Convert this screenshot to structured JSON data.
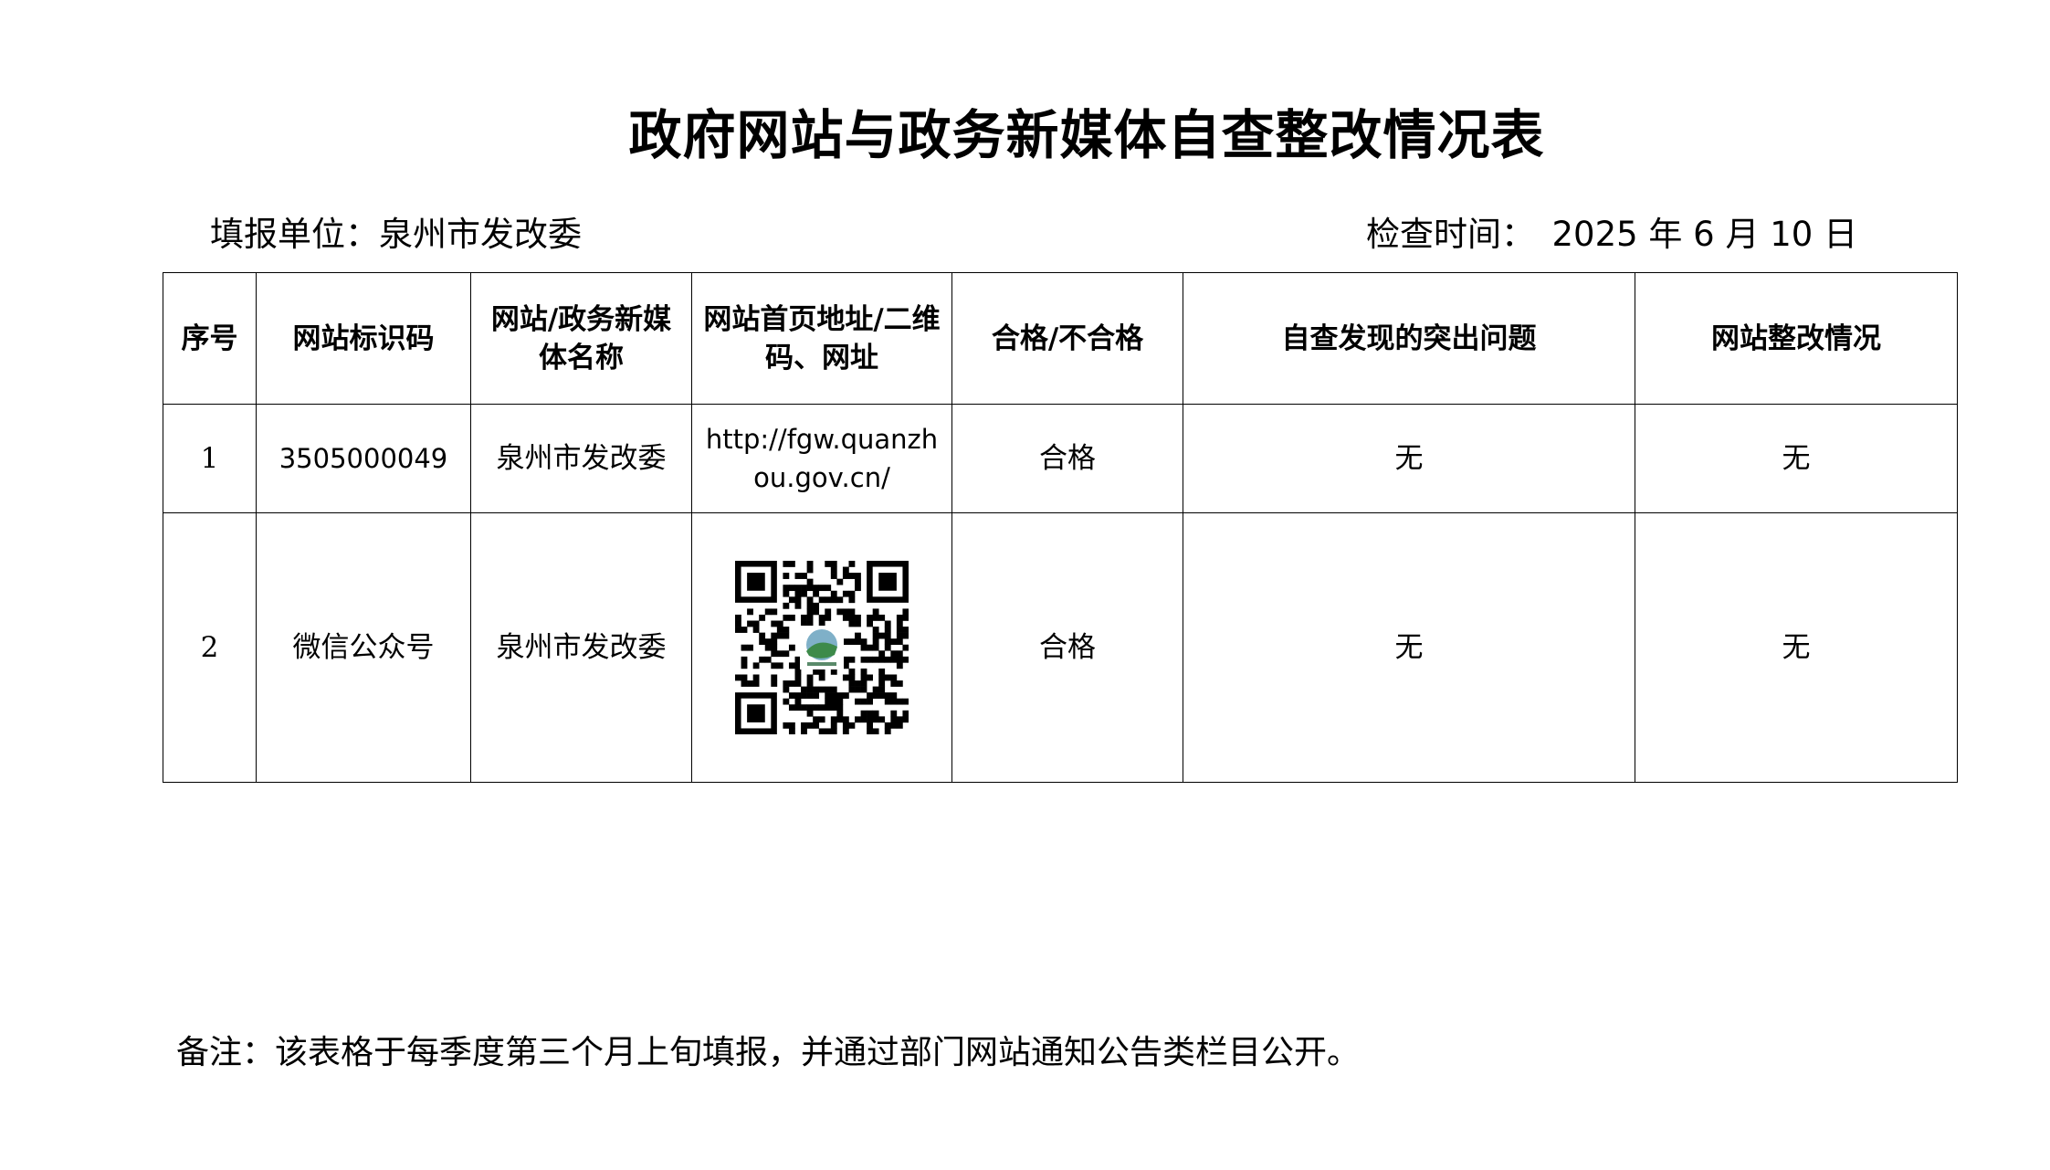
{
  "document": {
    "title": "政府网站与政务新媒体自查整改情况表",
    "reporter": "填报单位：泉州市发改委",
    "check_time": "检查时间：　2025 年 6 月 10 日"
  },
  "table": {
    "headers": [
      "序号",
      "网站标识码",
      "网站/政务新媒体名称",
      "网站首页地址/二维码、网址",
      "合格/不合格",
      "自查发现的突出问题",
      "网站整改情况"
    ],
    "rows": [
      {
        "index": "1",
        "site_code": "3505000049",
        "name": "泉州市发改委",
        "address": "http://fgw.quanzhou.gov.cn/",
        "status": "合格",
        "issues": "无",
        "rectification": "无"
      },
      {
        "index": "2",
        "site_code": "微信公众号",
        "name": "泉州市发改委",
        "address_icon": "qr-code-icon",
        "status": "合格",
        "issues": "无",
        "rectification": "无"
      }
    ]
  },
  "note": "备注：该表格于每季度第三个月上旬填报，并通过部门网站通知公告类栏目公开。"
}
